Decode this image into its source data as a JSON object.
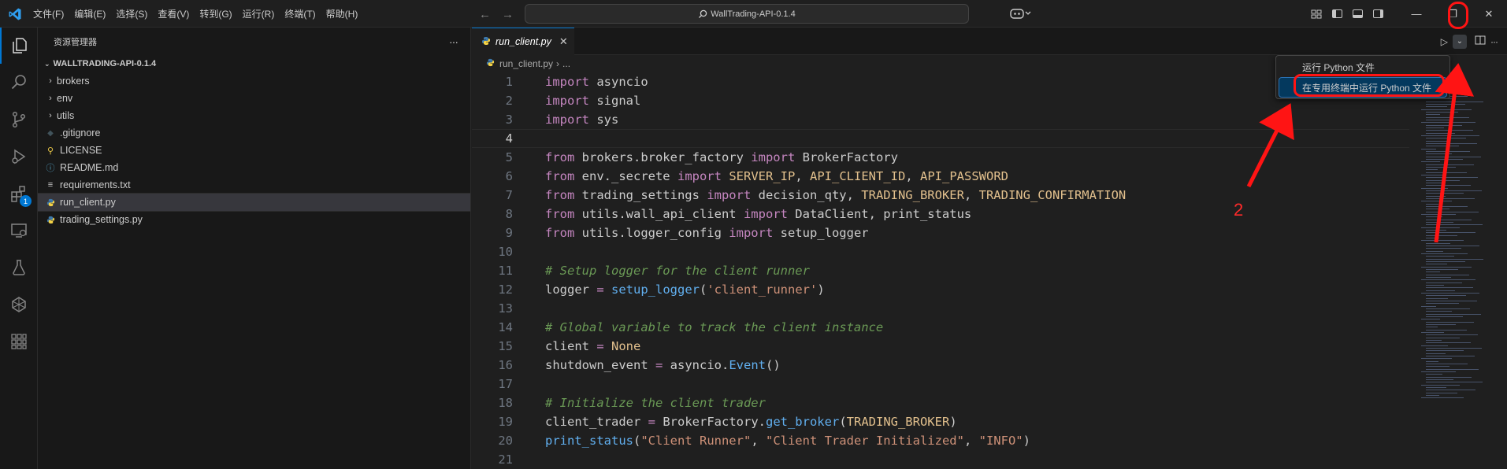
{
  "titlebar": {
    "menus": [
      "文件(F)",
      "编辑(E)",
      "选择(S)",
      "查看(V)",
      "转到(G)",
      "运行(R)",
      "终端(T)",
      "帮助(H)"
    ],
    "search_text": "WallTrading-API-0.1.4",
    "accent": "#0078d4"
  },
  "activitybar": {
    "icons": [
      "explorer-icon",
      "search-icon",
      "source-control-icon",
      "run-debug-icon",
      "extensions-icon",
      "remote-explorer-icon",
      "testing-icon",
      "github-actions-icon",
      "grid-icon"
    ],
    "extensions_badge": "1"
  },
  "sidebar": {
    "title": "资源管理器",
    "more": "···",
    "project": "WALLTRADING-API-0.1.4",
    "items": [
      {
        "name": "brokers",
        "type": "folder"
      },
      {
        "name": "env",
        "type": "folder"
      },
      {
        "name": "utils",
        "type": "folder"
      },
      {
        "name": ".gitignore",
        "type": "git"
      },
      {
        "name": "LICENSE",
        "type": "license"
      },
      {
        "name": "README.md",
        "type": "info"
      },
      {
        "name": "requirements.txt",
        "type": "text"
      },
      {
        "name": "run_client.py",
        "type": "python"
      },
      {
        "name": "trading_settings.py",
        "type": "python"
      }
    ]
  },
  "editor": {
    "tab_label": "run_client.py",
    "breadcrumb_file": "run_client.py",
    "breadcrumb_more": "...",
    "current_line": 4,
    "line_numbers": [
      "1",
      "2",
      "3",
      "4",
      "5",
      "6",
      "7",
      "8",
      "9",
      "10",
      "11",
      "12",
      "13",
      "14",
      "15",
      "16",
      "17",
      "18",
      "19",
      "20",
      "21"
    ]
  },
  "run_menu": {
    "items": [
      "运行 Python 文件",
      "在专用终端中运行 Python 文件"
    ]
  },
  "annotation": {
    "step_label": "2",
    "color": "#ff1414"
  }
}
